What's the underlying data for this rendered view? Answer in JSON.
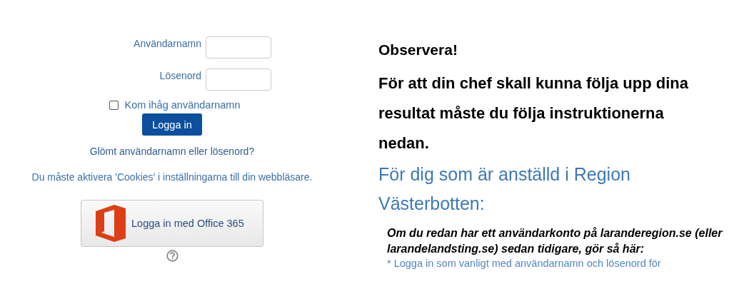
{
  "login": {
    "username_label": "Användarnamn",
    "password_label": "Lösenord",
    "remember": {
      "label": "Kom ihåg användarnamn",
      "checked": false
    },
    "submit": "Logga in",
    "forgot_link": "Glömt användarnamn eller lösenord?",
    "cookies_note": "Du måste aktivera 'Cookies' i inställningarna till din webbläsare.",
    "office_button": "Logga in med Office 365"
  },
  "info": {
    "title": "Observera!",
    "lead": "För att din chef skall kunna följa upp dina resultat måste du följa instruktionerna nedan.",
    "subheading": "För dig som är anställd i Region Västerbotten:",
    "note": "Om du redan har ett användarkonto på laranderegion.se (eller larandelandsting.se) sedan tidigare, gör så här:",
    "step": "* Logga in som vanligt med användarnamn och lösenord för"
  }
}
